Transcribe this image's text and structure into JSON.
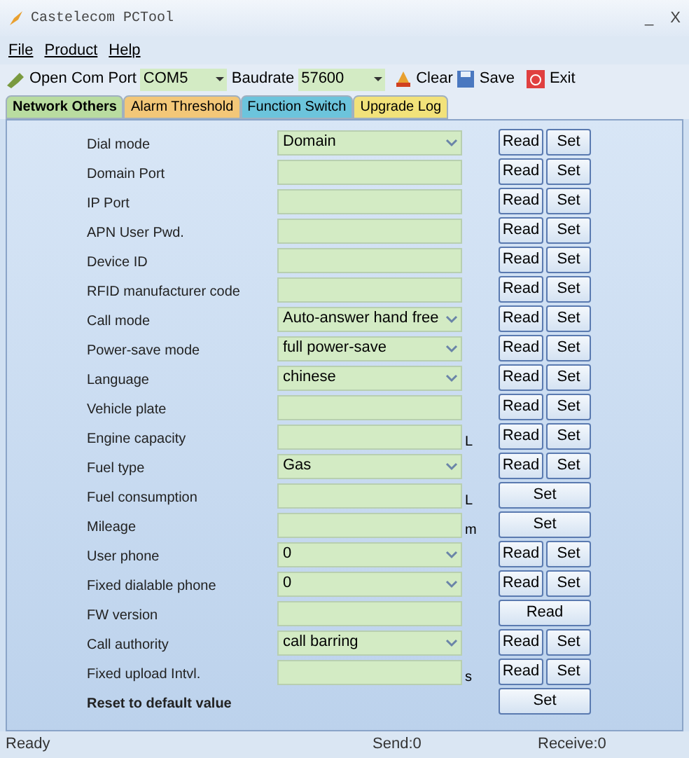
{
  "window": {
    "title": "Castelecom PCTool",
    "minimize": "_",
    "close": "X"
  },
  "menu": [
    "File",
    "Product",
    "Help"
  ],
  "toolbar": {
    "open_port": "Open Com Port",
    "port": "COM5",
    "baudrate_label": "Baudrate",
    "baudrate": "57600",
    "clear": "Clear",
    "save": "Save",
    "exit": "Exit"
  },
  "tabs": [
    {
      "label": "Network Others",
      "selected": true,
      "color": "#b9dca0"
    },
    {
      "label": "Alarm Threshold",
      "selected": false,
      "color": "#f3c778"
    },
    {
      "label": "Function Switch",
      "selected": false,
      "color": "#6cc4dc"
    },
    {
      "label": "Upgrade Log",
      "selected": false,
      "color": "#f2e27a"
    }
  ],
  "rows": [
    {
      "label": "Dial mode",
      "kind": "combo",
      "value": "Domain",
      "buttons": [
        "Read",
        "Set"
      ]
    },
    {
      "label": "Domain Port",
      "kind": "field",
      "buttons": [
        "Read",
        "Set"
      ]
    },
    {
      "label": "IP Port",
      "kind": "field",
      "buttons": [
        "Read",
        "Set"
      ]
    },
    {
      "label": "APN User Pwd.",
      "kind": "field",
      "buttons": [
        "Read",
        "Set"
      ]
    },
    {
      "label": "Device ID",
      "kind": "field",
      "buttons": [
        "Read",
        "Set"
      ]
    },
    {
      "label": "RFID manufacturer code",
      "kind": "field",
      "buttons": [
        "Read",
        "Set"
      ]
    },
    {
      "label": "Call mode",
      "kind": "combo",
      "value": "Auto-answer hand free",
      "buttons": [
        "Read",
        "Set"
      ]
    },
    {
      "label": "Power-save mode",
      "kind": "combo",
      "value": "full power-save",
      "buttons": [
        "Read",
        "Set"
      ]
    },
    {
      "label": "Language",
      "kind": "combo",
      "value": "chinese",
      "buttons": [
        "Read",
        "Set"
      ]
    },
    {
      "label": "Vehicle plate",
      "kind": "field",
      "buttons": [
        "Read",
        "Set"
      ]
    },
    {
      "label": "Engine capacity",
      "kind": "field",
      "unit": "L",
      "buttons": [
        "Read",
        "Set"
      ]
    },
    {
      "label": "Fuel type",
      "kind": "combo",
      "value": "Gas",
      "buttons": [
        "Read",
        "Set"
      ]
    },
    {
      "label": "Fuel consumption",
      "kind": "field",
      "unit": "L",
      "buttons": [
        "Set"
      ]
    },
    {
      "label": "Mileage",
      "kind": "field",
      "unit": "m",
      "buttons": [
        "Set"
      ]
    },
    {
      "label": "User phone",
      "kind": "combo",
      "value": "0",
      "buttons": [
        "Read",
        "Set"
      ]
    },
    {
      "label": "Fixed dialable phone",
      "kind": "combo",
      "value": "0",
      "buttons": [
        "Read",
        "Set"
      ]
    },
    {
      "label": "FW version",
      "kind": "field",
      "buttons": [
        "Read"
      ]
    },
    {
      "label": "Call authority",
      "kind": "combo",
      "value": "call barring",
      "buttons": [
        "Read",
        "Set"
      ]
    },
    {
      "label": "Fixed upload Intvl.",
      "kind": "field",
      "unit": "s",
      "buttons": [
        "Read",
        "Set"
      ]
    },
    {
      "label": "Reset to default value",
      "kind": "none",
      "buttons": [
        "Set"
      ]
    }
  ],
  "status_bar": {
    "state": "Ready",
    "send": "Send:0",
    "receive": "Receive:0"
  }
}
